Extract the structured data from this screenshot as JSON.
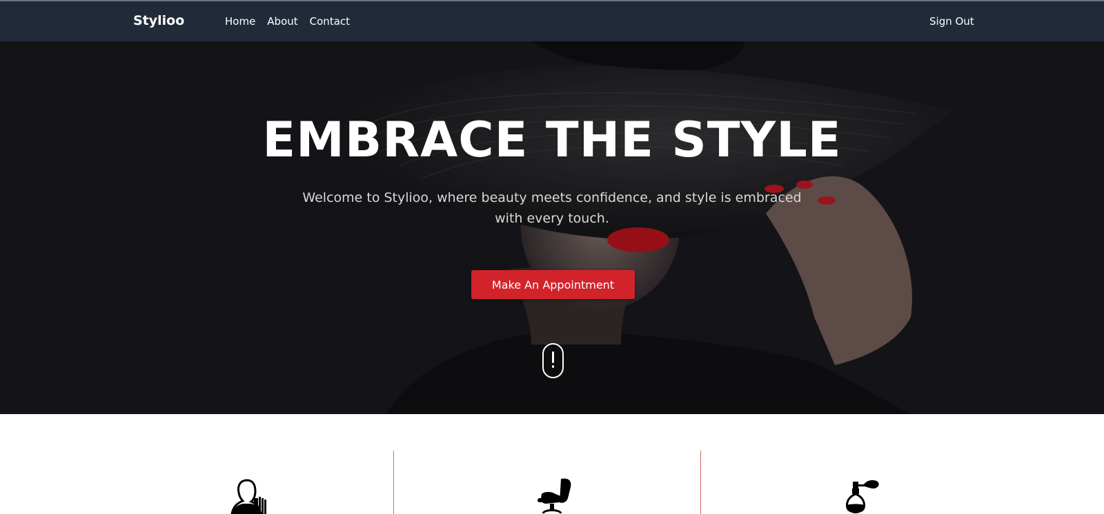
{
  "navbar": {
    "brand": "Stylioo",
    "links": [
      {
        "label": "Home"
      },
      {
        "label": "About"
      },
      {
        "label": "Contact"
      }
    ],
    "signout": "Sign Out"
  },
  "hero": {
    "title": "EMBRACE THE STYLE",
    "subtitle": "Welcome to Stylioo, where beauty meets confidence, and style is embraced with every touch.",
    "cta_label": "Make An Appointment"
  },
  "colors": {
    "nav_bg": "#212a39",
    "hero_bg": "#1c1c21",
    "accent": "#d2232a"
  },
  "services": {
    "icons": [
      "hairdresser-icon",
      "salon-chair-icon",
      "perfume-icon"
    ]
  }
}
